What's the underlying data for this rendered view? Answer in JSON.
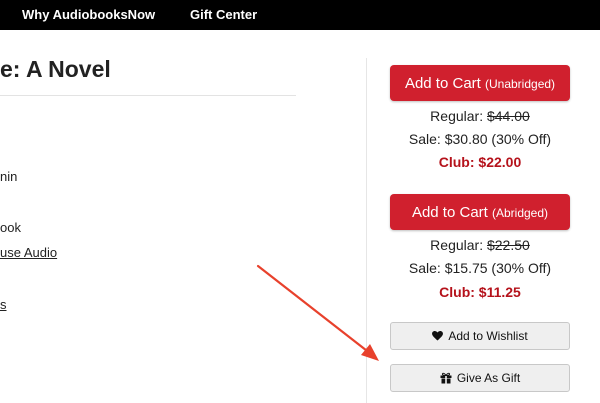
{
  "nav": {
    "why": "Why AudiobooksNow",
    "gift": "Gift Center"
  },
  "book": {
    "title": "e: A Novel"
  },
  "details": [
    "nin",
    "ook",
    "use Audio",
    "s"
  ],
  "unabridged": {
    "button_label": "Add to Cart",
    "edition": "(Unabridged)",
    "regular_label": "Regular:",
    "regular_price": "$44.00",
    "sale_text": "Sale: $30.80 (30% Off)",
    "club_text": "Club: $22.00"
  },
  "abridged": {
    "button_label": "Add to Cart",
    "edition": "(Abridged)",
    "regular_label": "Regular:",
    "regular_price": "$22.50",
    "sale_text": "Sale: $15.75 (30% Off)",
    "club_text": "Club: $11.25"
  },
  "actions": {
    "wishlist": "Add to Wishlist",
    "gift": "Give As Gift"
  },
  "colors": {
    "cart_red": "#d0202e",
    "club_red": "#b5121b",
    "annotation_arrow": "#e8412c"
  },
  "icons": {
    "wishlist": "heart-icon",
    "gift": "gift-icon"
  }
}
